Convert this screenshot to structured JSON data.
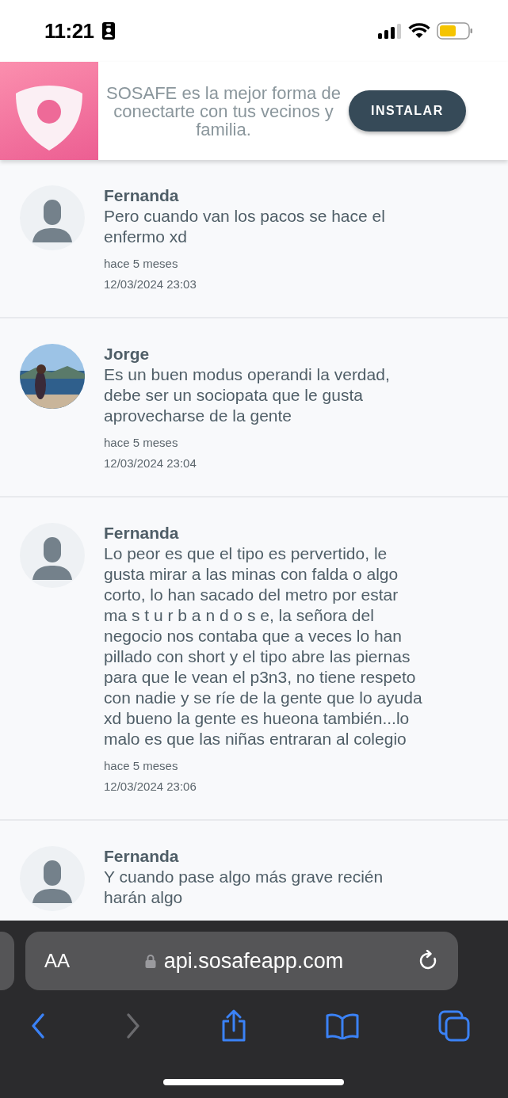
{
  "status_bar": {
    "time": "11:21"
  },
  "banner": {
    "text": "SOSAFE es la mejor forma de conectarte con tus vecinos y familia.",
    "button": "INSTALAR"
  },
  "comments": [
    {
      "author": "Fernanda",
      "avatar": {
        "kind": "default"
      },
      "text": "Pero cuando van los pacos se hace el enfermo xd",
      "ago": "hace 5 meses",
      "date": "12/03/2024 23:03"
    },
    {
      "author": "Jorge",
      "text": "Es un buen modus operandi la verdad, debe ser un sociopata que le gusta aprovecharse de la gente",
      "ago": "hace 5 meses",
      "date": "12/03/2024 23:04"
    },
    {
      "author": "Fernanda",
      "avatar": {
        "kind": "default"
      },
      "text": "Lo peor es que el tipo es pervertido, le gusta mirar a las minas con falda o algo corto, lo han sacado del metro por estar ma s t u r b a n d o s e, la señora del negocio nos contaba que a veces lo han pillado con short y el tipo abre las piernas para que le vean el p3n3, no tiene respeto con nadie y se ríe de la gente que lo ayuda xd bueno la gente es hueona también...lo malo es que las niñas entraran al colegio",
      "ago": "hace 5 meses",
      "date": "12/03/2024 23:06"
    },
    {
      "author": "Fernanda",
      "avatar": {
        "kind": "default"
      },
      "text": "Y cuando pase algo más grave recién harán algo"
    }
  ],
  "browser": {
    "text_size": "AA",
    "url": "api.sosafeapp.com",
    "back_disabled": false,
    "forward_disabled": true
  }
}
